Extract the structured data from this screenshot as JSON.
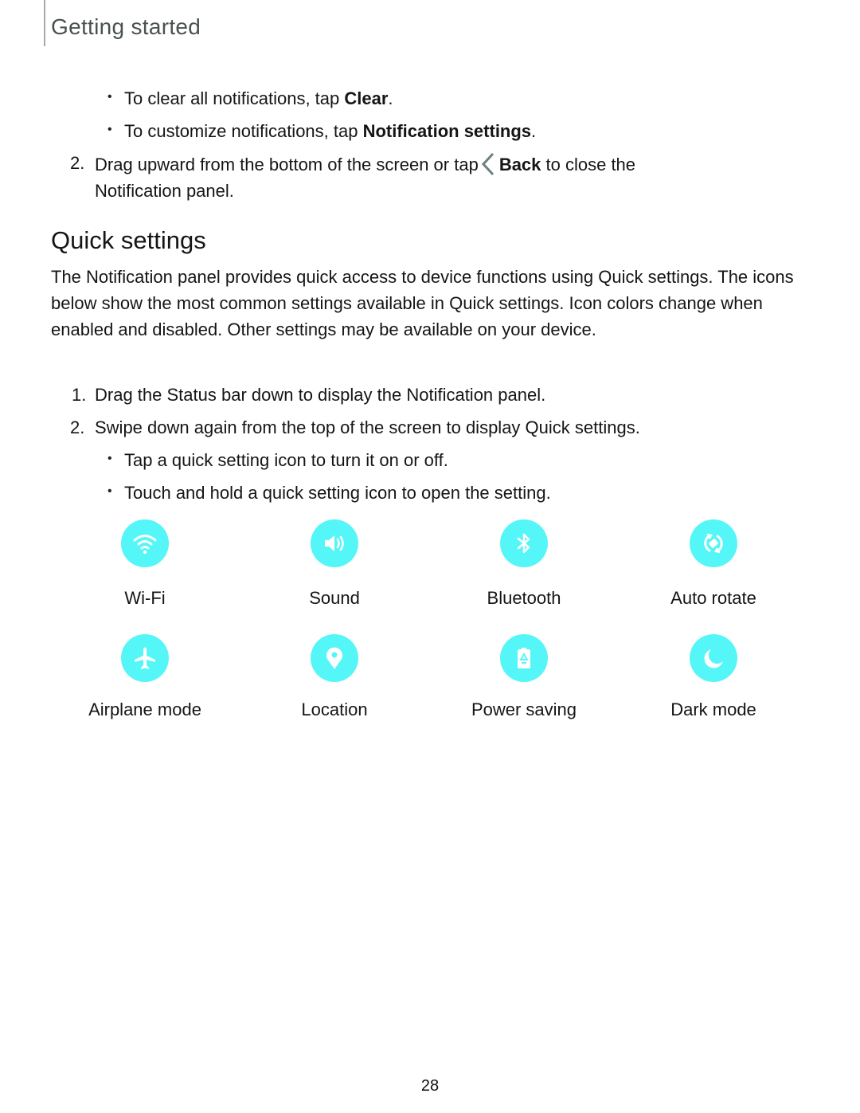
{
  "header": {
    "section": "Getting started"
  },
  "intro_steps": {
    "bullet_1": {
      "text": "To clear all notifications, tap ",
      "bold": "Clear",
      "suffix": "."
    },
    "bullet_2": {
      "text": "To customize notifications, tap ",
      "bold": "Notification settings",
      "suffix": "."
    },
    "step_2": {
      "number": "2.",
      "text": "Drag upward from the bottom of the screen or tap",
      "icon": "back-chevron-icon",
      "bold": "Back",
      "suffix": " to close the",
      "line2": "Notification panel."
    }
  },
  "quick_settings": {
    "title": "Quick settings",
    "description": "The Notification panel provides quick access to device functions using Quick settings. The icons below show the most common settings available in Quick settings. Icon colors change when enabled and disabled. Other settings may be available on your device.",
    "steps": [
      {
        "number": "1.",
        "text": "Drag the Status bar down to display the Notification panel."
      },
      {
        "number": "2.",
        "text": "Swipe down again from the top of the screen to display Quick settings."
      }
    ],
    "sub_bullets": [
      "Tap a quick setting icon to turn it on or off.",
      "Touch and hold a quick setting icon to open the setting."
    ],
    "icon_color": "#55f6f8",
    "tiles": [
      {
        "label": "Wi-Fi",
        "icon": "wifi-icon"
      },
      {
        "label": "Sound",
        "icon": "sound-icon"
      },
      {
        "label": "Bluetooth",
        "icon": "bluetooth-icon"
      },
      {
        "label": "Auto rotate",
        "icon": "auto-rotate-icon"
      },
      {
        "label": "Airplane mode",
        "icon": "airplane-icon"
      },
      {
        "label": "Location",
        "icon": "location-icon"
      },
      {
        "label": "Power saving",
        "icon": "power-saving-icon"
      },
      {
        "label": "Dark mode",
        "icon": "dark-mode-icon"
      }
    ]
  },
  "footer": {
    "page_number": "28"
  }
}
